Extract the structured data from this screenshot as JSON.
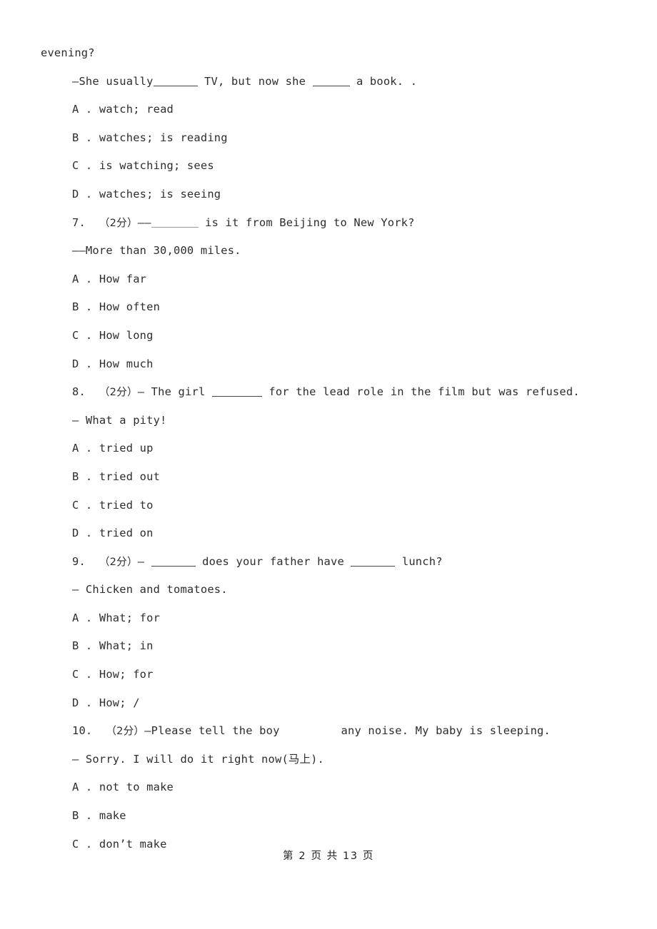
{
  "document": {
    "type": "exam-paper",
    "page_label": "第 2 页 共 13 页",
    "page_number": 2,
    "total_pages": 13,
    "text_color": "#2d2d2d",
    "background_color": "#ffffff"
  },
  "carryover": {
    "stem_tail": "evening?",
    "answer_line_pre": "—She usually",
    "answer_line_mid": " TV, but now she ",
    "answer_line_post": " a book. ."
  },
  "questions": [
    {
      "number": "",
      "score": "",
      "options": [
        {
          "letter": "A",
          "sep": " . ",
          "text": "watch; read"
        },
        {
          "letter": "B",
          "sep": " . ",
          "text": "watches; is reading"
        },
        {
          "letter": "C",
          "sep": " . ",
          "text": "is watching; sees"
        },
        {
          "letter": "D",
          "sep": " . ",
          "text": "watches; is seeing"
        }
      ]
    },
    {
      "number": "7.",
      "score": "（2分）",
      "stem_pre": "——",
      "stem_post": " is it from Beijing to New York?",
      "answer_line": "——More than 30,000 miles.",
      "options": [
        {
          "letter": "A",
          "sep": " . ",
          "text": "How far"
        },
        {
          "letter": "B",
          "sep": " . ",
          "text": "How often"
        },
        {
          "letter": "C",
          "sep": " . ",
          "text": "How long"
        },
        {
          "letter": "D",
          "sep": " . ",
          "text": "How much"
        }
      ]
    },
    {
      "number": "8.",
      "score": "（2分）",
      "stem_pre": "— The girl ",
      "stem_post": " for the lead role in the film but was refused.",
      "answer_line": "— What a pity!",
      "options": [
        {
          "letter": "A",
          "sep": " . ",
          "text": "tried up"
        },
        {
          "letter": "B",
          "sep": " . ",
          "text": "tried out"
        },
        {
          "letter": "C",
          "sep": " . ",
          "text": "tried to"
        },
        {
          "letter": "D",
          "sep": " . ",
          "text": "tried on"
        }
      ]
    },
    {
      "number": "9.",
      "score": "（2分）",
      "stem_pre": "— ",
      "stem_mid": " does your father have ",
      "stem_post": " lunch?",
      "answer_line": "— Chicken and tomatoes.",
      "options": [
        {
          "letter": "A",
          "sep": " . ",
          "text": "What; for"
        },
        {
          "letter": "B",
          "sep": " . ",
          "text": "What; in"
        },
        {
          "letter": "C",
          "sep": " . ",
          "text": "How; for"
        },
        {
          "letter": "D",
          "sep": " . ",
          "text": "How; /"
        }
      ]
    },
    {
      "number": "10.",
      "score": "（2分）",
      "stem_pre": "—Please tell the boy",
      "stem_post": "any noise. My baby is sleeping.",
      "answer_line": "— Sorry. I will do it right now(马上).",
      "options": [
        {
          "letter": "A",
          "sep": " . ",
          "text": "not to make"
        },
        {
          "letter": "B",
          "sep": " . ",
          "text": "make"
        },
        {
          "letter": "C",
          "sep": " . ",
          "text": "don’t make"
        }
      ]
    }
  ]
}
